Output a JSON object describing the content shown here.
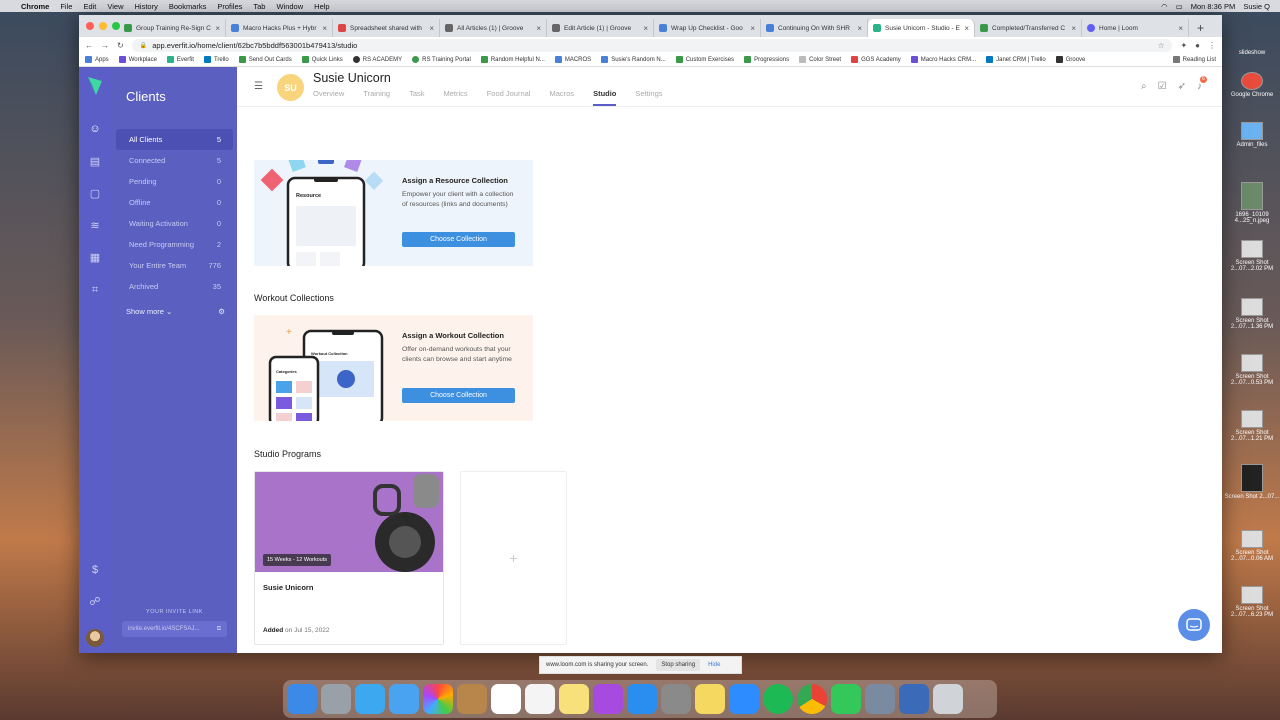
{
  "menubar": {
    "apple": "",
    "items": [
      "Chrome",
      "File",
      "Edit",
      "View",
      "History",
      "Bookmarks",
      "Profiles",
      "Tab",
      "Window",
      "Help"
    ],
    "clock": "Mon 8:36 PM",
    "user": "Susie Q"
  },
  "desktop": {
    "items": [
      "slideshow",
      "Google Chrome",
      "Admin_files",
      "1696_10109 4...25_n.jpeg",
      "Screen Shot 2...07...2.02 PM",
      "Screen Shot 2...07...1.36 PM",
      "Screen Shot 2...07...0.53 PM",
      "Screen Shot 2...07...1.21 PM",
      "Screen Shot 2...07...",
      "Screen Shot 2...07...0.06 AM",
      "Screen Shot 2...07...6.23 PM"
    ]
  },
  "browser": {
    "tabs": [
      {
        "label": "Group Training Re-Sign C",
        "active": false
      },
      {
        "label": "Macro Hacks Plus + Hybr",
        "active": false
      },
      {
        "label": "Spreadsheet shared with",
        "active": false
      },
      {
        "label": "All Articles (1) | Groove",
        "active": false
      },
      {
        "label": "Edit Article (1) | Groove",
        "active": false
      },
      {
        "label": "Wrap Up Checklist - Goo",
        "active": false
      },
      {
        "label": "Continuing On With SHR",
        "active": false
      },
      {
        "label": "Susie Unicorn - Studio - E",
        "active": true
      },
      {
        "label": "Completed/Transferred C",
        "active": false
      },
      {
        "label": "Home | Loom",
        "active": false
      }
    ],
    "url": "app.everfit.io/home/client/62bc7b5bddf563001b479413/studio",
    "bookmarks": [
      "Apps",
      "Workplace",
      "Everfit",
      "Trello",
      "Send Out Cards",
      "Quick Links",
      "RS ACADEMY",
      "RS Training Portal",
      "Random Helpful N...",
      "MACROS",
      "Susie's Random N...",
      "Custom Exercises",
      "Progressions",
      "Color Street",
      "GGS Academy",
      "Macro Hacks CRM...",
      "Janet CRM | Trello",
      "Groove",
      "Reading List"
    ]
  },
  "sidebar": {
    "title": "Clients",
    "items": [
      {
        "label": "All Clients",
        "count": "5",
        "active": true
      },
      {
        "label": "Connected",
        "count": "5"
      },
      {
        "label": "Pending",
        "count": "0"
      },
      {
        "label": "Offline",
        "count": "0"
      },
      {
        "label": "Waiting Activation",
        "count": "0"
      },
      {
        "label": "Need Programming",
        "count": "2"
      },
      {
        "label": "Your Entire Team",
        "count": "776"
      },
      {
        "label": "Archived",
        "count": "35"
      }
    ],
    "show_more": "Show more",
    "invite_label": "YOUR INVITE LINK",
    "invite_url": "invite.everfit.io/4SCFSAJ..."
  },
  "client": {
    "initials": "SU",
    "name": "Susie Unicorn",
    "tabs": [
      {
        "label": "Overview",
        "active": false
      },
      {
        "label": "Training",
        "active": false
      },
      {
        "label": "Task",
        "active": false
      },
      {
        "label": "Metrics",
        "active": false
      },
      {
        "label": "Food Journal",
        "active": false
      },
      {
        "label": "Macros",
        "active": false
      },
      {
        "label": "Studio",
        "active": true
      },
      {
        "label": "Settings",
        "active": false
      }
    ],
    "notification_count": "6"
  },
  "resource_card": {
    "art_label": "Resource",
    "title": "Assign a Resource Collection",
    "desc": "Empower your client with a collection of resources (links and documents)",
    "button": "Choose Collection"
  },
  "workout_section": {
    "heading": "Workout Collections",
    "art_label_phone": "Workout Collection",
    "art_label_cat": "Categories",
    "title": "Assign a Workout Collection",
    "desc": "Offer on-demand workouts that your clients can browse and start anytime",
    "button": "Choose Collection"
  },
  "programs": {
    "heading": "Studio Programs",
    "items": [
      {
        "tag": "15 Weeks - 12 Workouts",
        "title": "Susie Unicorn",
        "added_label": "Added",
        "added_date": "on Jul 15, 2022"
      }
    ],
    "add_symbol": "+"
  },
  "sharebar": {
    "text": "www.loom.com is sharing your screen.",
    "stop": "Stop sharing",
    "hide": "Hide"
  },
  "colors": {
    "rail": "#5b5ec6",
    "sidebar": "#5a5fc0",
    "accent": "#3d8fe0",
    "avatar": "#f8d57d"
  }
}
